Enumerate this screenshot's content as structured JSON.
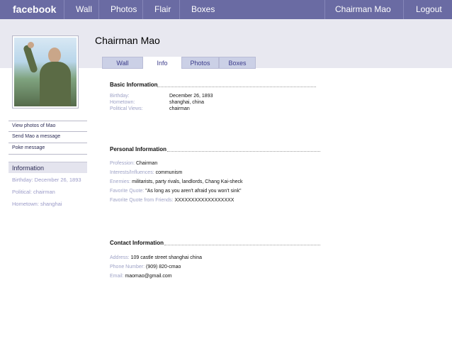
{
  "nav": {
    "logo": "facebook",
    "links": [
      "Wall",
      "Photos",
      "Flair",
      "Boxes"
    ],
    "user_name": "Chairman Mao",
    "logout": "Logout"
  },
  "profile": {
    "name": "Chairman Mao",
    "tabs": [
      "Wall",
      "Info",
      "Photos",
      "Boxes"
    ],
    "active_tab": "Info"
  },
  "sidebar": {
    "actions": [
      "View photos of Mao",
      "Send Mao a message",
      "Poke message"
    ],
    "info_title": "Information",
    "info_lines": [
      "Birthday: December 26, 1893",
      "Political: chairman",
      "Hometown: shanghai"
    ]
  },
  "basic": {
    "title": "Basic Information",
    "rows": [
      {
        "label": "Birthday:",
        "value": "December 26, 1893"
      },
      {
        "label": "Hometown:",
        "value": "shanghai, china"
      },
      {
        "label": "Political Views:",
        "value": "chairman"
      }
    ]
  },
  "personal": {
    "title": "Personal Information",
    "rows": [
      {
        "label": "Profession:",
        "value": "Chairman"
      },
      {
        "label": "Interests/Influences:",
        "value": "communism"
      },
      {
        "label": "Enemies:",
        "value": "militarists, party rivals, landlords, Chang Kai-sheck"
      },
      {
        "label": "Favorite Quote:",
        "value": "\"As long as you aren't afraid you won't sink\""
      },
      {
        "label": "Favorite Quote from Friends:",
        "value": "XXXXXXXXXXXXXXXXXX"
      }
    ]
  },
  "contact": {
    "title": "Contact Information",
    "rows": [
      {
        "label": "Address:",
        "value": "109  castle street shanghai china"
      },
      {
        "label": "Phone Number:",
        "value": "(909) 820-cmao"
      },
      {
        "label": "Email:",
        "value": "maomao@gmail.com"
      }
    ]
  },
  "colors": {
    "nav_bg": "#6a6ba3",
    "band_bg": "#e8e8f0",
    "tab_bg": "#cbd0e6",
    "label": "#9ea2c6"
  },
  "icons": {
    "profile_photo": "profile-photo"
  }
}
